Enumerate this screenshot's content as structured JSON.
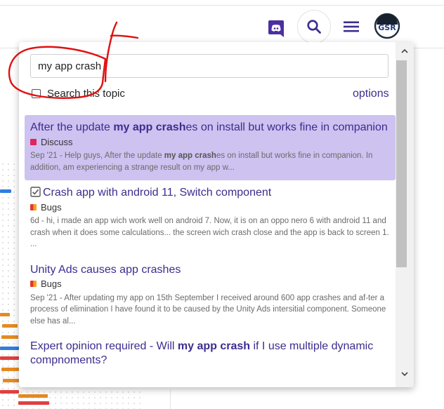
{
  "header": {
    "icons": [
      "discord-icon",
      "search-icon",
      "hamburger-menu-icon",
      "avatar"
    ],
    "avatar_text": "GSR"
  },
  "search": {
    "query": "my app crash",
    "topic_checkbox_label": "Search this topic",
    "options_label": "options"
  },
  "results": [
    {
      "title_before": "After the update ",
      "title_bold": "my app crash",
      "title_after": "es on install but works fine in companion",
      "category": "Discuss",
      "category_color": "#e0245e",
      "blurb_before": "Sep '21 - Help guys, After the update ",
      "blurb_bold": "my app crash",
      "blurb_after": "es on install but works fine in companion. In addition, am experiencing a strange result on my app w...",
      "highlighted": true
    },
    {
      "title_before": "Crash app with android 11, Switch component",
      "title_bold": "",
      "title_after": "",
      "status_icon": "solved-checkbox-icon",
      "category": "Bugs",
      "category_color": "#f0821e",
      "blurb_before": "6d - hi, i made an app wich work well on android 7. Now, it is on an oppo nero 6 with android 11 and crash when it does some calculations... the screen wich crash close and the app is back to screen 1. ...",
      "blurb_bold": "",
      "blurb_after": "",
      "highlighted": false
    },
    {
      "title_before": "Unity Ads causes app crashes",
      "title_bold": "",
      "title_after": "",
      "category": "Bugs",
      "category_color": "#f0821e",
      "blurb_before": "Sep '21 - After updating my app on 15th September I received around 600 app crashes and af-ter a process of elimination I have found it to be caused by the Unity Ads intersitial component. Someone else has al...",
      "blurb_bold": "",
      "blurb_after": "",
      "highlighted": false
    },
    {
      "title_before": "Expert opinion required - Will ",
      "title_bold": "my app crash",
      "title_after": " if I use multiple dynamic compnoments?",
      "category": "",
      "category_color": "",
      "blurb_before": "",
      "blurb_bold": "",
      "blurb_after": "",
      "highlighted": false
    }
  ],
  "colors": {
    "link": "#3e2c8e",
    "highlight_bg": "#cdc2f0",
    "annotation": "#e01010",
    "discord": "#4b2fa0"
  }
}
